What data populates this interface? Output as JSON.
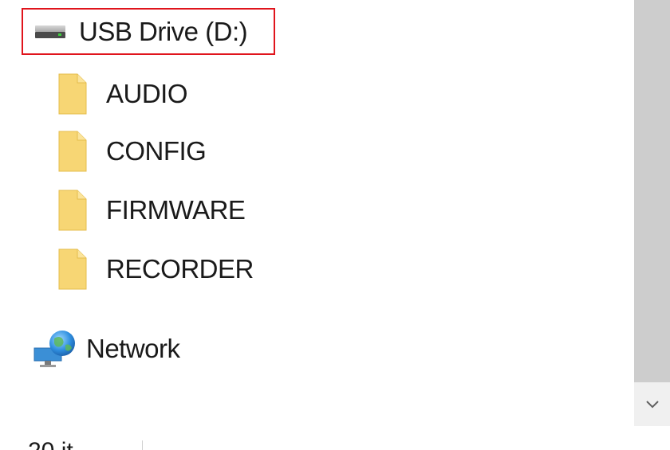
{
  "tree": {
    "drive": {
      "label": "USB Drive (D:)",
      "icon": "usb-drive-icon",
      "highlight_color": "#e0141c"
    },
    "folders": [
      {
        "label": "AUDIO",
        "icon": "folder-icon"
      },
      {
        "label": "CONFIG",
        "icon": "folder-icon"
      },
      {
        "label": "FIRMWARE",
        "icon": "folder-icon"
      },
      {
        "label": "RECORDER",
        "icon": "folder-icon"
      }
    ],
    "network": {
      "label": "Network",
      "icon": "network-icon"
    }
  },
  "status_bar": {
    "item_count": "20 it"
  },
  "scrollbar": {
    "arrow": "chevron-down-icon"
  }
}
